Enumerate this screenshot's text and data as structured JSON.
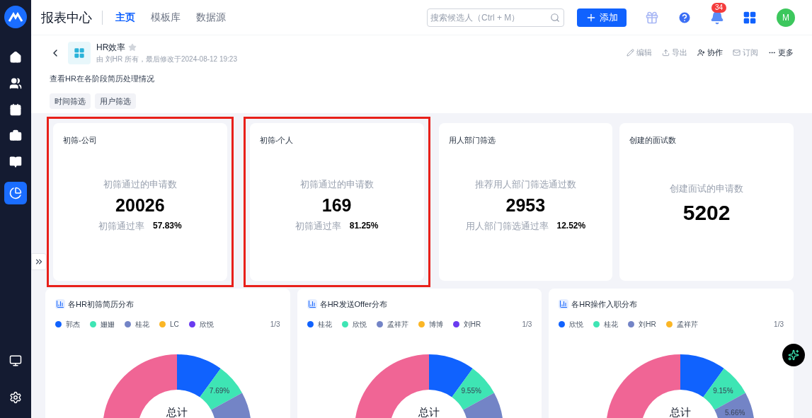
{
  "header": {
    "title": "报表中心",
    "tabs": [
      {
        "label": "主页",
        "selected": true
      },
      {
        "label": "模板库",
        "selected": false
      },
      {
        "label": "数据源",
        "selected": false
      }
    ],
    "search": {
      "placeholder": "搜索候选人（Ctrl + M）"
    },
    "add_button": "添加",
    "notifications": "34",
    "avatar": "M"
  },
  "report": {
    "title": "HR效率",
    "meta": "由 刘HR 所有，最后修改于2024-08-12 19:23",
    "description": "查看HR在各阶段简历处理情况",
    "actions": [
      {
        "label": "编辑",
        "kind": "edit",
        "disabled": true
      },
      {
        "label": "导出",
        "kind": "export",
        "disabled": true
      },
      {
        "label": "协作",
        "kind": "share",
        "disabled": false
      },
      {
        "label": "订阅",
        "kind": "mail",
        "disabled": true
      },
      {
        "label": "更多",
        "kind": "more",
        "disabled": false
      }
    ],
    "filters": [
      "时间筛选",
      "用户筛选"
    ]
  },
  "metrics": [
    {
      "title": "初筛-公司",
      "label": "初筛通过的申请数",
      "value": "20026",
      "rate_label": "初筛通过率",
      "rate": "57.83%",
      "highlighted": true
    },
    {
      "title": "初筛-个人",
      "label": "初筛通过的申请数",
      "value": "169",
      "rate_label": "初筛通过率",
      "rate": "81.25%",
      "highlighted": true
    },
    {
      "title": "用人部门筛选",
      "label": "推荐用人部门筛选通过数",
      "value": "2953",
      "rate_label": "用人部门筛选通过率",
      "rate": "12.52%",
      "highlighted": false
    },
    {
      "title": "创建的面试数",
      "label": "创建面试的申请数",
      "value": "5202",
      "highlighted": false
    }
  ],
  "charts": [
    {
      "title": "各HR初筛简历分布",
      "legend": [
        {
          "name": "郭杰",
          "color": "#1062fe"
        },
        {
          "name": "姗姗",
          "color": "#3ee5b4"
        },
        {
          "name": "桂花",
          "color": "#7384c6"
        },
        {
          "name": "LC",
          "color": "#fbb625"
        },
        {
          "name": "欣悦",
          "color": "#6a3bf0"
        }
      ],
      "pager": "1/3",
      "labels": [
        "7.69%"
      ],
      "center": "总计"
    },
    {
      "title": "各HR发送Offer分布",
      "legend": [
        {
          "name": "桂花",
          "color": "#1062fe"
        },
        {
          "name": "欣悦",
          "color": "#3ee5b4"
        },
        {
          "name": "孟祥芹",
          "color": "#7384c6"
        },
        {
          "name": "博博",
          "color": "#fbb625"
        },
        {
          "name": "刘HR",
          "color": "#6a3bf0"
        }
      ],
      "pager": "1/3",
      "labels": [
        "9.55%"
      ],
      "center": "总计"
    },
    {
      "title": "各HR操作入职分布",
      "legend": [
        {
          "name": "欣悦",
          "color": "#1062fe"
        },
        {
          "name": "桂花",
          "color": "#3ee5b4"
        },
        {
          "name": "刘HR",
          "color": "#7384c6"
        },
        {
          "name": "孟祥芹",
          "color": "#fbb625"
        }
      ],
      "pager": "1/3",
      "labels": [
        "9.15%",
        "5.66%"
      ],
      "center": "总计"
    }
  ]
}
